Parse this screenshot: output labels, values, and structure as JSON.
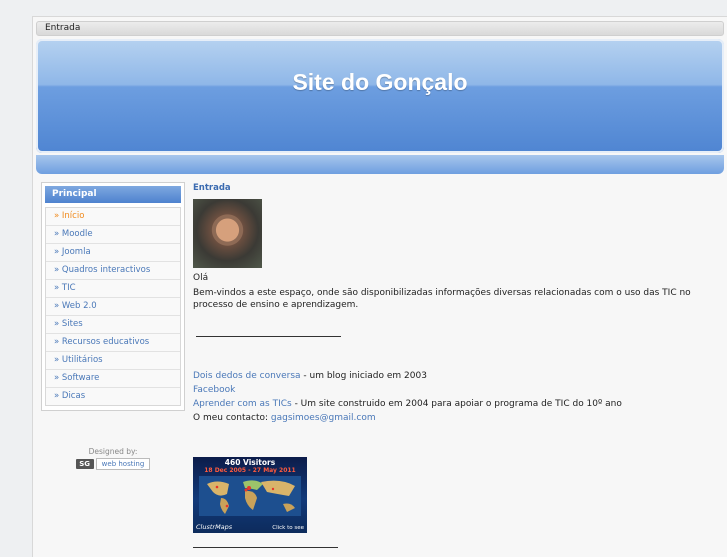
{
  "breadcrumb": "Entrada",
  "site_title": "Site do Gonçalo",
  "sidebar": {
    "header": "Principal",
    "items": [
      {
        "label": "» Início",
        "active": true
      },
      {
        "label": "» Moodle"
      },
      {
        "label": "» Joomla"
      },
      {
        "label": "» Quadros interactivos"
      },
      {
        "label": "» TIC"
      },
      {
        "label": "» Web 2.0"
      },
      {
        "label": "» Sites"
      },
      {
        "label": "» Recursos educativos"
      },
      {
        "label": "» Utilitários"
      },
      {
        "label": "» Software"
      },
      {
        "label": "» Dicas"
      }
    ],
    "designed_by": "Designed by:",
    "badge_logo": "SG",
    "badge_text": "web hosting"
  },
  "content": {
    "title": "Entrada",
    "hello": "Olá",
    "intro": "Bem-vindos a este espaço, onde são disponibilizadas informações diversas relacionadas com o uso das TIC no processo de ensino e aprendizagem.",
    "links": [
      {
        "link": "Dois dedos de conversa",
        "text": " - um blog iniciado em 2003"
      },
      {
        "link": "Facebook",
        "text": ""
      },
      {
        "link": "Aprender com as TICs",
        "text": " - Um site construido em 2004 para apoiar o programa de TIC do 10º ano"
      }
    ],
    "contact_label": "O meu contacto: ",
    "contact_email": "gagsimoes@gmail.com",
    "clustrmaps": {
      "visitors": "460 Visitors",
      "dates": "18 Dec 2005 - 27 May 2011",
      "brand": "ClustrMaps",
      "cta": "Click to see"
    }
  },
  "colors": {
    "link": "#4a78b8",
    "active": "#f08a1c",
    "banner": "#4f85d2"
  }
}
